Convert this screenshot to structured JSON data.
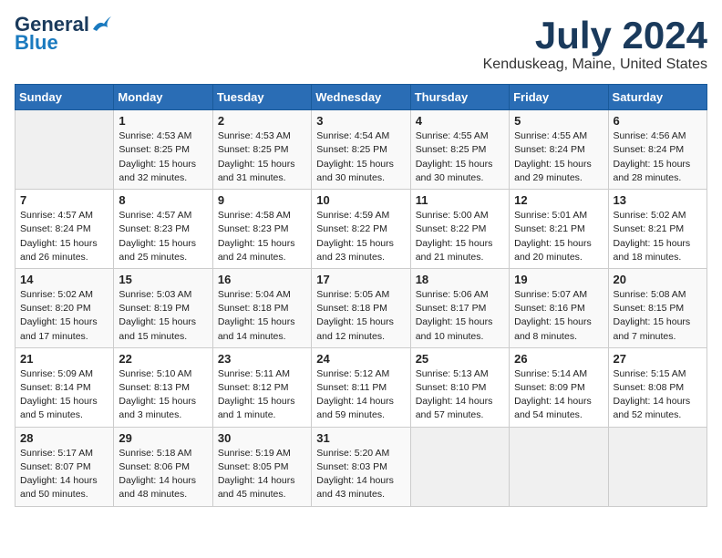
{
  "header": {
    "logo_line1": "General",
    "logo_line2": "Blue",
    "month": "July 2024",
    "location": "Kenduskeag, Maine, United States"
  },
  "weekdays": [
    "Sunday",
    "Monday",
    "Tuesday",
    "Wednesday",
    "Thursday",
    "Friday",
    "Saturday"
  ],
  "weeks": [
    [
      {
        "day": "",
        "info": ""
      },
      {
        "day": "1",
        "info": "Sunrise: 4:53 AM\nSunset: 8:25 PM\nDaylight: 15 hours\nand 32 minutes."
      },
      {
        "day": "2",
        "info": "Sunrise: 4:53 AM\nSunset: 8:25 PM\nDaylight: 15 hours\nand 31 minutes."
      },
      {
        "day": "3",
        "info": "Sunrise: 4:54 AM\nSunset: 8:25 PM\nDaylight: 15 hours\nand 30 minutes."
      },
      {
        "day": "4",
        "info": "Sunrise: 4:55 AM\nSunset: 8:25 PM\nDaylight: 15 hours\nand 30 minutes."
      },
      {
        "day": "5",
        "info": "Sunrise: 4:55 AM\nSunset: 8:24 PM\nDaylight: 15 hours\nand 29 minutes."
      },
      {
        "day": "6",
        "info": "Sunrise: 4:56 AM\nSunset: 8:24 PM\nDaylight: 15 hours\nand 28 minutes."
      }
    ],
    [
      {
        "day": "7",
        "info": "Sunrise: 4:57 AM\nSunset: 8:24 PM\nDaylight: 15 hours\nand 26 minutes."
      },
      {
        "day": "8",
        "info": "Sunrise: 4:57 AM\nSunset: 8:23 PM\nDaylight: 15 hours\nand 25 minutes."
      },
      {
        "day": "9",
        "info": "Sunrise: 4:58 AM\nSunset: 8:23 PM\nDaylight: 15 hours\nand 24 minutes."
      },
      {
        "day": "10",
        "info": "Sunrise: 4:59 AM\nSunset: 8:22 PM\nDaylight: 15 hours\nand 23 minutes."
      },
      {
        "day": "11",
        "info": "Sunrise: 5:00 AM\nSunset: 8:22 PM\nDaylight: 15 hours\nand 21 minutes."
      },
      {
        "day": "12",
        "info": "Sunrise: 5:01 AM\nSunset: 8:21 PM\nDaylight: 15 hours\nand 20 minutes."
      },
      {
        "day": "13",
        "info": "Sunrise: 5:02 AM\nSunset: 8:21 PM\nDaylight: 15 hours\nand 18 minutes."
      }
    ],
    [
      {
        "day": "14",
        "info": "Sunrise: 5:02 AM\nSunset: 8:20 PM\nDaylight: 15 hours\nand 17 minutes."
      },
      {
        "day": "15",
        "info": "Sunrise: 5:03 AM\nSunset: 8:19 PM\nDaylight: 15 hours\nand 15 minutes."
      },
      {
        "day": "16",
        "info": "Sunrise: 5:04 AM\nSunset: 8:18 PM\nDaylight: 15 hours\nand 14 minutes."
      },
      {
        "day": "17",
        "info": "Sunrise: 5:05 AM\nSunset: 8:18 PM\nDaylight: 15 hours\nand 12 minutes."
      },
      {
        "day": "18",
        "info": "Sunrise: 5:06 AM\nSunset: 8:17 PM\nDaylight: 15 hours\nand 10 minutes."
      },
      {
        "day": "19",
        "info": "Sunrise: 5:07 AM\nSunset: 8:16 PM\nDaylight: 15 hours\nand 8 minutes."
      },
      {
        "day": "20",
        "info": "Sunrise: 5:08 AM\nSunset: 8:15 PM\nDaylight: 15 hours\nand 7 minutes."
      }
    ],
    [
      {
        "day": "21",
        "info": "Sunrise: 5:09 AM\nSunset: 8:14 PM\nDaylight: 15 hours\nand 5 minutes."
      },
      {
        "day": "22",
        "info": "Sunrise: 5:10 AM\nSunset: 8:13 PM\nDaylight: 15 hours\nand 3 minutes."
      },
      {
        "day": "23",
        "info": "Sunrise: 5:11 AM\nSunset: 8:12 PM\nDaylight: 15 hours\nand 1 minute."
      },
      {
        "day": "24",
        "info": "Sunrise: 5:12 AM\nSunset: 8:11 PM\nDaylight: 14 hours\nand 59 minutes."
      },
      {
        "day": "25",
        "info": "Sunrise: 5:13 AM\nSunset: 8:10 PM\nDaylight: 14 hours\nand 57 minutes."
      },
      {
        "day": "26",
        "info": "Sunrise: 5:14 AM\nSunset: 8:09 PM\nDaylight: 14 hours\nand 54 minutes."
      },
      {
        "day": "27",
        "info": "Sunrise: 5:15 AM\nSunset: 8:08 PM\nDaylight: 14 hours\nand 52 minutes."
      }
    ],
    [
      {
        "day": "28",
        "info": "Sunrise: 5:17 AM\nSunset: 8:07 PM\nDaylight: 14 hours\nand 50 minutes."
      },
      {
        "day": "29",
        "info": "Sunrise: 5:18 AM\nSunset: 8:06 PM\nDaylight: 14 hours\nand 48 minutes."
      },
      {
        "day": "30",
        "info": "Sunrise: 5:19 AM\nSunset: 8:05 PM\nDaylight: 14 hours\nand 45 minutes."
      },
      {
        "day": "31",
        "info": "Sunrise: 5:20 AM\nSunset: 8:03 PM\nDaylight: 14 hours\nand 43 minutes."
      },
      {
        "day": "",
        "info": ""
      },
      {
        "day": "",
        "info": ""
      },
      {
        "day": "",
        "info": ""
      }
    ]
  ]
}
